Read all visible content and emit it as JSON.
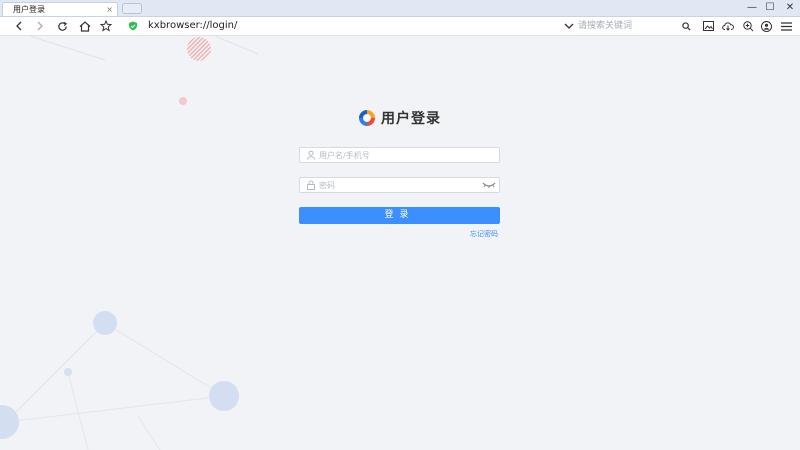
{
  "tab": {
    "title": "用户登录",
    "close": "×"
  },
  "window": {
    "minimize": "—",
    "maximize": "☐",
    "close": "✕"
  },
  "toolbar": {
    "url": "kxbrowser://login/",
    "search_placeholder": "请搜索关键词"
  },
  "login": {
    "title": "用户登录",
    "username_placeholder": "用户名/手机号",
    "password_placeholder": "密码",
    "submit_label": "登录",
    "forgot_label": "忘记密码"
  },
  "colors": {
    "accent": "#3b8fff",
    "background": "#f1f3f6",
    "secure": "#2ebd4f"
  }
}
